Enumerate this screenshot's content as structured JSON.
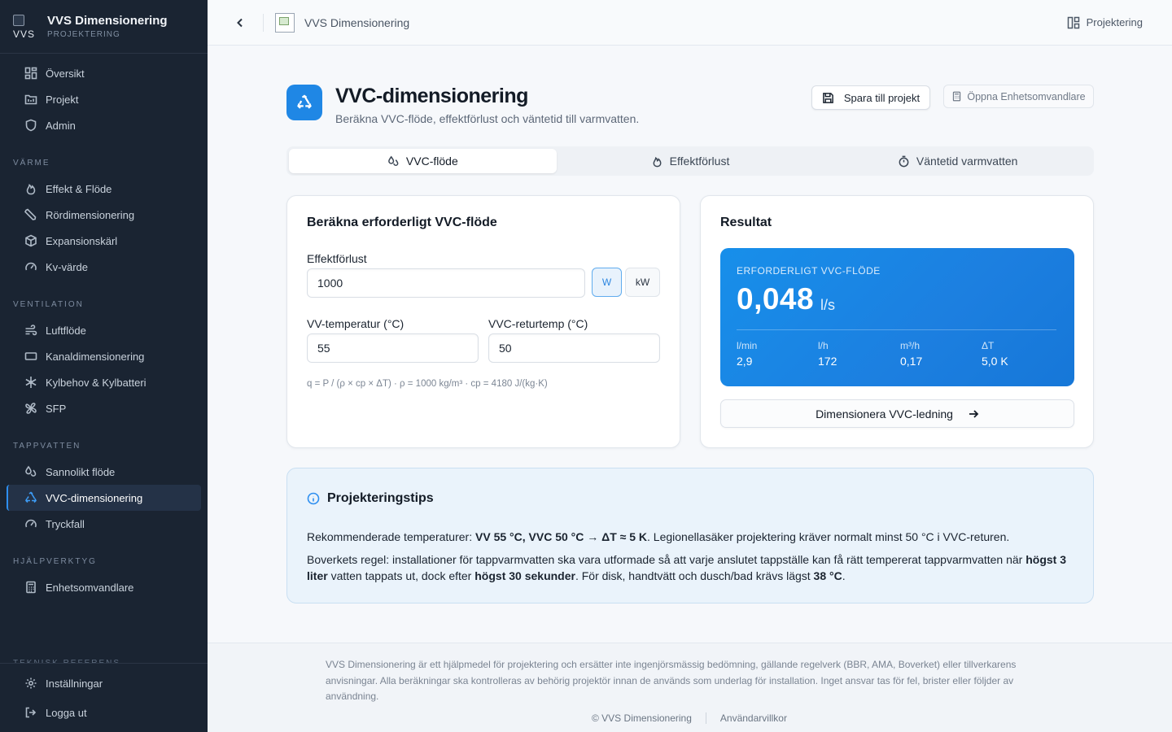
{
  "brand": {
    "title": "VVS Dimensionering",
    "subtitle": "PROJEKTERING",
    "logo_text": "VVS"
  },
  "sidebar": {
    "main_items": [
      {
        "label": "Översikt",
        "icon": "grid-icon"
      },
      {
        "label": "Projekt",
        "icon": "folder-icon"
      },
      {
        "label": "Admin",
        "icon": "shield-icon"
      }
    ],
    "sections": [
      {
        "title": "VÄRME",
        "items": [
          {
            "label": "Effekt & Flöde",
            "icon": "flame-icon"
          },
          {
            "label": "Rördimensionering",
            "icon": "wrench-icon"
          },
          {
            "label": "Expansionskärl",
            "icon": "box-icon"
          },
          {
            "label": "Kv-värde",
            "icon": "gauge-icon"
          }
        ]
      },
      {
        "title": "VENTILATION",
        "items": [
          {
            "label": "Luftflöde",
            "icon": "wind-icon"
          },
          {
            "label": "Kanaldimensionering",
            "icon": "rectangle-icon"
          },
          {
            "label": "Kylbehov & Kylbatteri",
            "icon": "snowflake-icon"
          },
          {
            "label": "SFP",
            "icon": "fan-icon"
          }
        ]
      },
      {
        "title": "TAPPVATTEN",
        "items": [
          {
            "label": "Sannolikt flöde",
            "icon": "droplets-icon"
          },
          {
            "label": "VVC-dimensionering",
            "icon": "recycle-icon",
            "active": true
          },
          {
            "label": "Tryckfall",
            "icon": "gauge-icon"
          }
        ]
      },
      {
        "title": "HJÄLPVERKTYG",
        "items": [
          {
            "label": "Enhetsomvandlare",
            "icon": "calculator-icon"
          }
        ]
      }
    ],
    "clipped_section": "TEKNISK REFERENS",
    "bottom": [
      {
        "label": "Inställningar",
        "icon": "gear-icon"
      },
      {
        "label": "Logga ut",
        "icon": "logout-icon"
      }
    ]
  },
  "topbar": {
    "title": "VVS Dimensionering",
    "right_label": "Projektering"
  },
  "page": {
    "title": "VVC-dimensionering",
    "subtitle": "Beräkna VVC-flöde, effektförlust och väntetid till varmvatten.",
    "save_button": "Spara till projekt",
    "open_converter_button": "Öppna Enhetsomvandlare"
  },
  "tabs": [
    {
      "label": "VVC-flöde",
      "active": true
    },
    {
      "label": "Effektförlust"
    },
    {
      "label": "Väntetid varmvatten"
    }
  ],
  "input_card": {
    "title": "Beräkna erforderligt VVC-flöde",
    "effect_label": "Effektförlust",
    "effect_value": "1000",
    "unit_w": "W",
    "unit_kw": "kW",
    "selected_unit": "W",
    "vv_temp_label": "VV-temperatur (°C)",
    "vv_temp_value": "55",
    "vvc_temp_label": "VVC-returtemp (°C)",
    "vvc_temp_value": "50",
    "formula": "q = P / (ρ × cp × ΔT) · ρ = 1000 kg/m³ · cp = 4180 J/(kg·K)"
  },
  "result_card": {
    "title": "Resultat",
    "label": "ERFORDERLIGT VVC-FLÖDE",
    "value": "0,048",
    "unit": "l/s",
    "metrics": [
      {
        "key": "l/min",
        "value": "2,9"
      },
      {
        "key": "l/h",
        "value": "172"
      },
      {
        "key": "m³/h",
        "value": "0,17"
      },
      {
        "key": "ΔT",
        "value": "5,0 K"
      }
    ],
    "action_button": "Dimensionera VVC-ledning"
  },
  "tips": {
    "title": "Projekteringstips",
    "p1_a": "Rekommenderade temperaturer: ",
    "p1_b": "VV 55 °C, VVC 50 °C → ΔT ≈ 5 K",
    "p1_c": ". Legionellasäker projektering kräver normalt minst 50 °C i VVC-returen.",
    "p2_a": "Boverkets regel: installationer för tappvarmvatten ska vara utformade så att varje anslutet tappställe kan få rätt tempererat tappvarmvatten när ",
    "p2_b": "högst 3 liter",
    "p2_c": " vatten tappats ut, dock efter ",
    "p2_d": "högst 30 sekunder",
    "p2_e": ". För disk, handtvätt och dusch/bad krävs lägst ",
    "p2_f": "38 °C",
    "p2_g": "."
  },
  "footer": {
    "disclaimer": "VVS Dimensionering är ett hjälpmedel för projektering och ersätter inte ingenjörsmässig bedömning, gällande regelverk (BBR, AMA, Boverket) eller tillverkarens anvisningar. Alla beräkningar ska kontrolleras av behörig projektör innan de används som underlag för installation. Inget ansvar tas för fel, brister eller följder av användning.",
    "copyright": "© VVS Dimensionering",
    "terms": "Användarvillkor"
  },
  "colors": {
    "accent": "#1f87e5",
    "sidebar_bg": "#1a2432",
    "tips_bg": "#eaf3fb"
  }
}
